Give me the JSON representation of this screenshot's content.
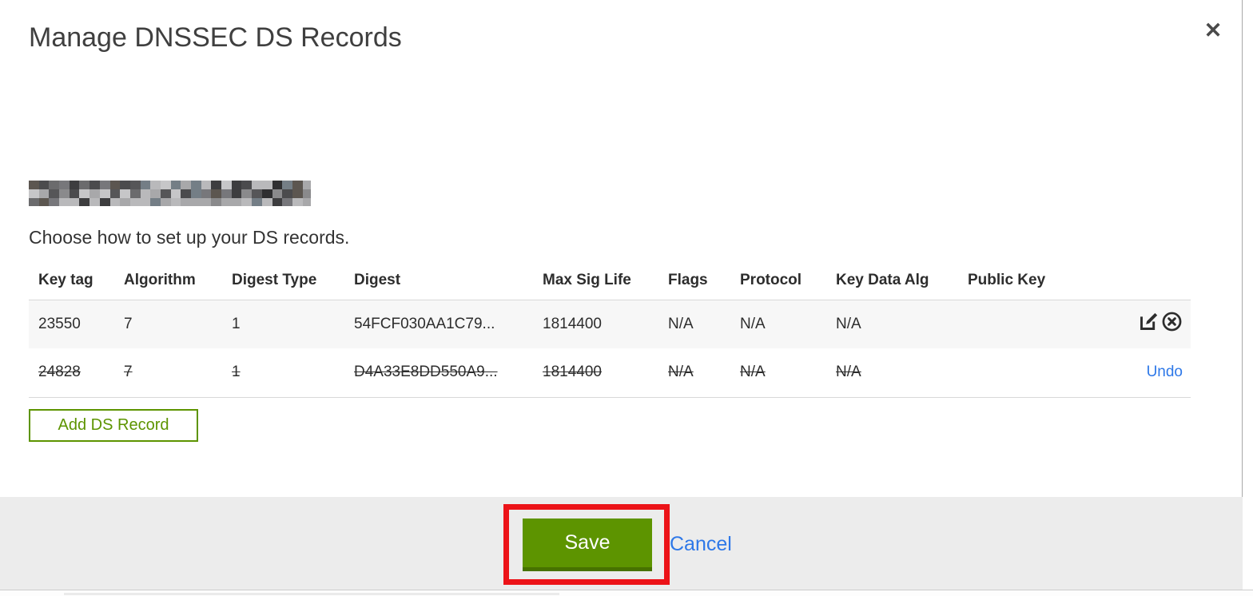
{
  "colors": {
    "green": "#5d9400",
    "green_dark": "#477200",
    "link_blue": "#2e78e8",
    "annotation_red": "#ec1318",
    "row_highlight": "#f7f7f7",
    "footer_gray": "#ececec"
  },
  "modal": {
    "title": "Manage DNSSEC DS Records",
    "close_icon_glyph": "✕",
    "instruction": "Choose how to set up your DS records.",
    "table": {
      "headers": [
        "Key tag",
        "Algorithm",
        "Digest Type",
        "Digest",
        "Max Sig Life",
        "Flags",
        "Protocol",
        "Key Data Alg",
        "Public Key"
      ],
      "rows": [
        {
          "key_tag": "23550",
          "algorithm": "7",
          "digest_type": "1",
          "digest": "54FCF030AA1C79...",
          "max_sig_life": "1814400",
          "flags": "N/A",
          "protocol": "N/A",
          "key_data_alg": "N/A",
          "public_key": "",
          "state": "current",
          "actions": [
            "edit-icon",
            "delete-circle-x-icon"
          ]
        },
        {
          "key_tag": "24828",
          "algorithm": "7",
          "digest_type": "1",
          "digest": "D4A33E8DD550A9...",
          "max_sig_life": "1814400",
          "flags": "N/A",
          "protocol": "N/A",
          "key_data_alg": "N/A",
          "public_key": "",
          "state": "deleted",
          "undo_label": "Undo"
        }
      ]
    },
    "add_button_label": "Add DS Record",
    "footer": {
      "save_label": "Save",
      "cancel_label": "Cancel"
    }
  }
}
